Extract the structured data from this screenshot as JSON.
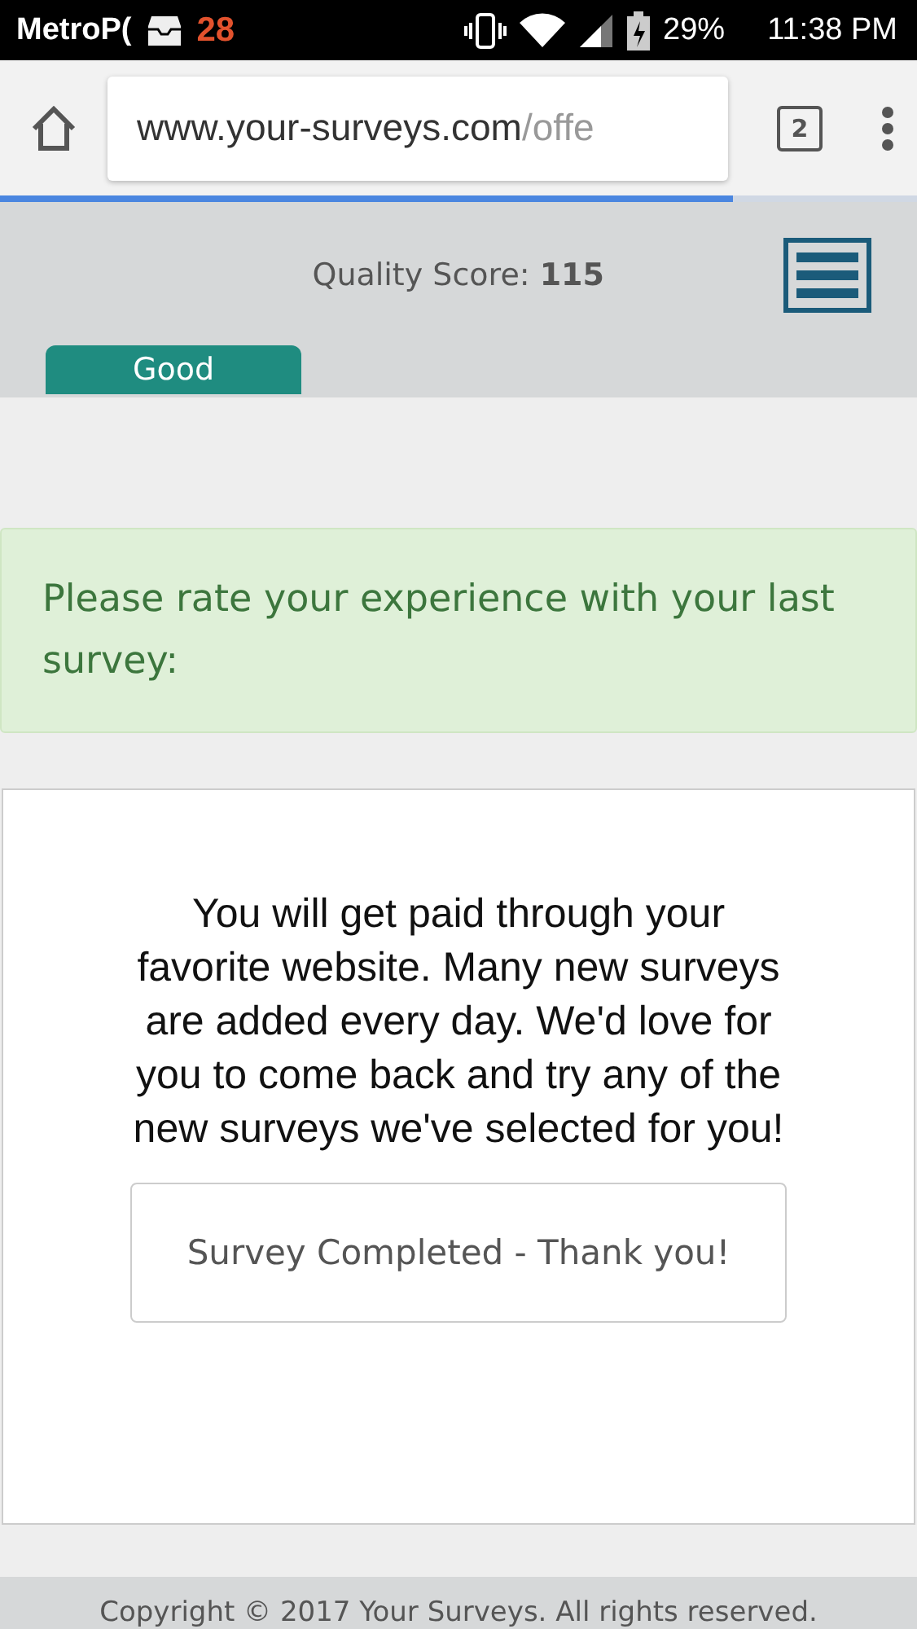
{
  "status_bar": {
    "carrier": "MetroP(",
    "notification_count": "28",
    "battery": "29%",
    "time": "11:38 PM"
  },
  "browser": {
    "url_host": "www.your-surveys.com",
    "url_path": "/offe",
    "tab_count": "2",
    "loading": {
      "level": 0.8
    }
  },
  "header": {
    "score_label": "Quality Score:",
    "score_value": "115",
    "rating": "Good"
  },
  "alert": {
    "text": "Please rate your experience with your last survey:"
  },
  "card": {
    "message": "You will get paid through your favorite website. Many new surveys are added every day. We'd love for you to come back and try any of the new surveys we've selected for you!",
    "button": "Survey Completed - Thank you!"
  },
  "footer": {
    "text": "Copyright © 2017 Your Surveys. All rights reserved."
  }
}
